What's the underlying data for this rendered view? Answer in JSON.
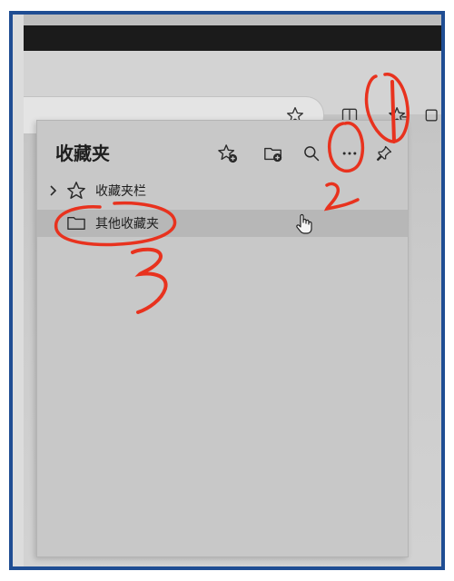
{
  "panel": {
    "title": "收藏夹",
    "items": [
      {
        "label": "收藏夹栏",
        "icon": "star-icon",
        "expandable": true
      },
      {
        "label": "其他收藏夹",
        "icon": "folder-icon",
        "expandable": false,
        "selected": true
      }
    ]
  },
  "header_buttons": [
    "add-favorite-icon",
    "add-folder-icon",
    "search-icon",
    "more-options-icon",
    "pin-icon"
  ],
  "toolbar_icons": [
    "star-icon",
    "split-screen-icon",
    "favorites-icon",
    "collections-icon"
  ],
  "annotations": {
    "color": "#e8321e",
    "marks": [
      "1",
      "2",
      "3"
    ]
  },
  "colors": {
    "frame_border": "#1f4d93",
    "panel_bg": "#c8c8c8",
    "selected_row": "#b7b7b7"
  }
}
